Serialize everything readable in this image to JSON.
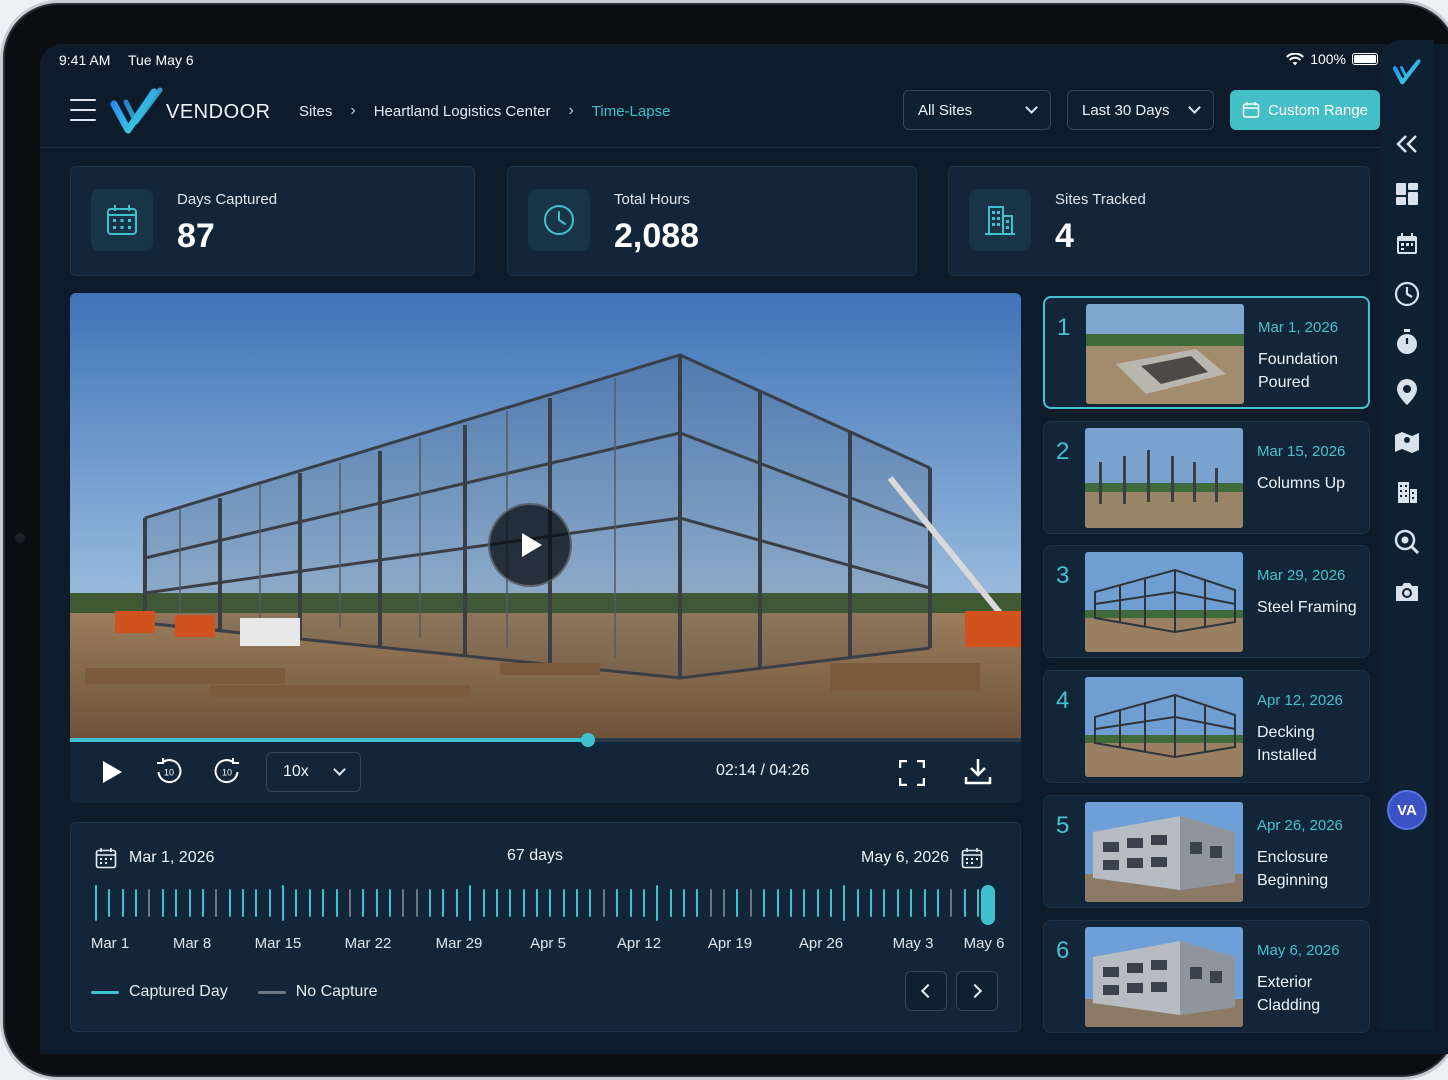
{
  "status_bar": {
    "time": "9:41 AM",
    "date": "Tue May 6",
    "battery": "100%"
  },
  "brand": {
    "name": "VENDOOR",
    "accent": "#3fc2cf",
    "logo_gradient": [
      "#2a7ff2",
      "#3fe0d8"
    ]
  },
  "breadcrumb": [
    "Sites",
    "Heartland Logistics Center",
    "Time-Lapse"
  ],
  "filters": {
    "site_select": "All Sites",
    "range_select": "Last 30 Days",
    "custom_range_label": "Custom Range"
  },
  "stats": [
    {
      "label": "Days Captured",
      "value": "87",
      "icon": "calendar-icon"
    },
    {
      "label": "Total Hours",
      "value": "2,088",
      "icon": "clock-icon"
    },
    {
      "label": "Sites Tracked",
      "value": "4",
      "icon": "building-icon"
    }
  ],
  "player": {
    "speed": "10x",
    "timecode": "02:14 / 04:26",
    "progress": 0.545
  },
  "timeline": {
    "start_date": "Mar 1, 2026",
    "end_date": "May 6, 2026",
    "span_label": "67 days",
    "month_labels": [
      "Mar 1",
      "Mar 8",
      "Mar 15",
      "Mar 22",
      "Mar 29",
      "Apr 5",
      "Apr 12",
      "Apr 19",
      "Apr 26",
      "May 3",
      "May 6"
    ],
    "legend": {
      "captured": "Captured Day",
      "missing": "No Capture"
    },
    "no_capture_days": [
      4,
      9,
      19,
      23,
      24,
      38,
      46,
      47,
      49,
      56,
      64
    ]
  },
  "milestones": [
    {
      "num": "1",
      "date": "Mar 1, 2026",
      "title": "Foundation Poured",
      "stage": "foundation"
    },
    {
      "num": "2",
      "date": "Mar 15, 2026",
      "title": "Columns Up",
      "stage": "columns"
    },
    {
      "num": "3",
      "date": "Mar 29, 2026",
      "title": "Steel Framing",
      "stage": "steel"
    },
    {
      "num": "4",
      "date": "Apr 12, 2026",
      "title": "Decking Installed",
      "stage": "steel"
    },
    {
      "num": "5",
      "date": "Apr 26, 2026",
      "title": "Enclosure Beginning",
      "stage": "enclosure"
    },
    {
      "num": "6",
      "date": "May 6, 2026",
      "title": "Exterior Cladding",
      "stage": "enclosure"
    }
  ],
  "rail": {
    "icons": [
      "collapse-icon",
      "dashboard-icon",
      "calendar-icon",
      "clock-icon",
      "stopwatch-icon",
      "location-pin-icon",
      "map-icon",
      "buildings-icon",
      "search-site-icon",
      "camera-icon"
    ],
    "avatar_initials": "VA"
  }
}
